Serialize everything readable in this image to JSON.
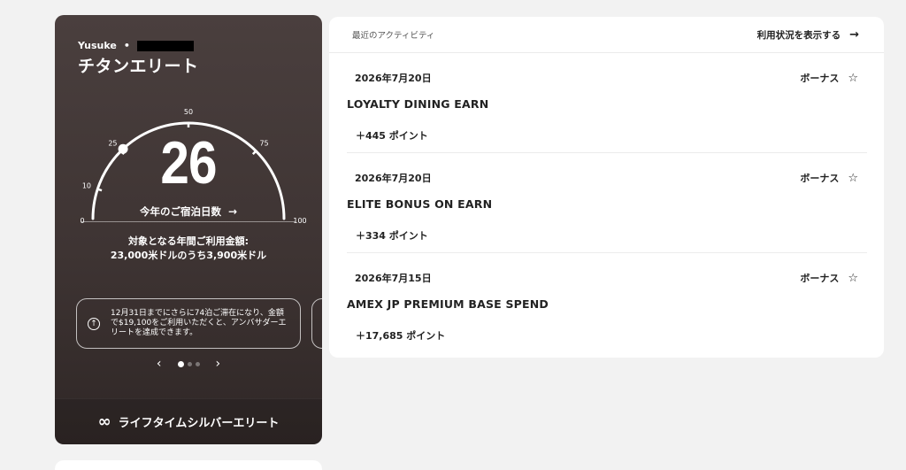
{
  "status": {
    "member_name": "Yusuke",
    "separator": "•",
    "tier": "チタンエリート",
    "gauge": {
      "ticks": [
        "0",
        "10",
        "25",
        "50",
        "75",
        "100"
      ],
      "max": 100,
      "current": 26
    },
    "nights_value": "26",
    "nights_label": "今年のご宿泊日数",
    "spend_line1": "対象となる年間ご利用金額:",
    "spend_line2": "23,000米ドルのうち3,900米ドル",
    "promo_text": "12月31日までにさらに74泊ご滞在になり、金額で$19,100をご利用いただくと、アンバサダーエリートを達成できます。",
    "carousel": {
      "prev": "‹",
      "next": "›",
      "pages": 3,
      "active": 0
    },
    "lifetime_label": "ライフタイムシルバーエリート"
  },
  "activity": {
    "title": "最近のアクティビティ",
    "view_link": "利用状況を表示する",
    "entries": [
      {
        "date": "2026年7月20日",
        "type": "ボーナス",
        "name": "LOYALTY DINING EARN",
        "points": "＋445 ポイント"
      },
      {
        "date": "2026年7月20日",
        "type": "ボーナス",
        "name": "ELITE BONUS ON EARN",
        "points": "＋334 ポイント"
      },
      {
        "date": "2026年7月15日",
        "type": "ボーナス",
        "name": "AMEX JP PREMIUM BASE SPEND",
        "points": "＋17,685 ポイント"
      }
    ]
  },
  "colors": {
    "card_bg": "#3e3433",
    "page_bg": "#f2f2f2",
    "panel_bg": "#ffffff"
  }
}
